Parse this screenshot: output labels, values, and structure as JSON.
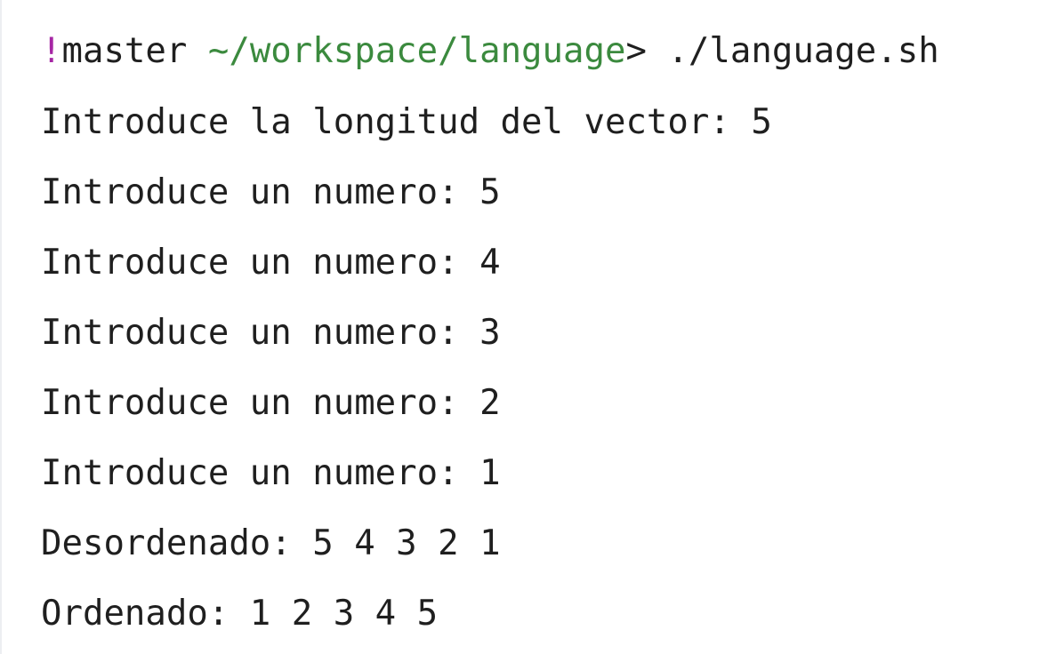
{
  "terminal": {
    "prompt": {
      "bang": "!",
      "branch": "master",
      "path": "~/workspace/language",
      "symbol": ">",
      "command": "./language.sh"
    },
    "lines": [
      "Introduce la longitud del vector: 5",
      "Introduce un numero: 5",
      "Introduce un numero: 4",
      "Introduce un numero: 3",
      "Introduce un numero: 2",
      "Introduce un numero: 1",
      "Desordenado: 5 4 3 2 1",
      "Ordenado: 1 2 3 4 5"
    ]
  },
  "colors": {
    "background": "#ffffff",
    "text": "#1f1f1f",
    "prompt_bang": "#a626a4",
    "prompt_path": "#3b8a3e"
  }
}
